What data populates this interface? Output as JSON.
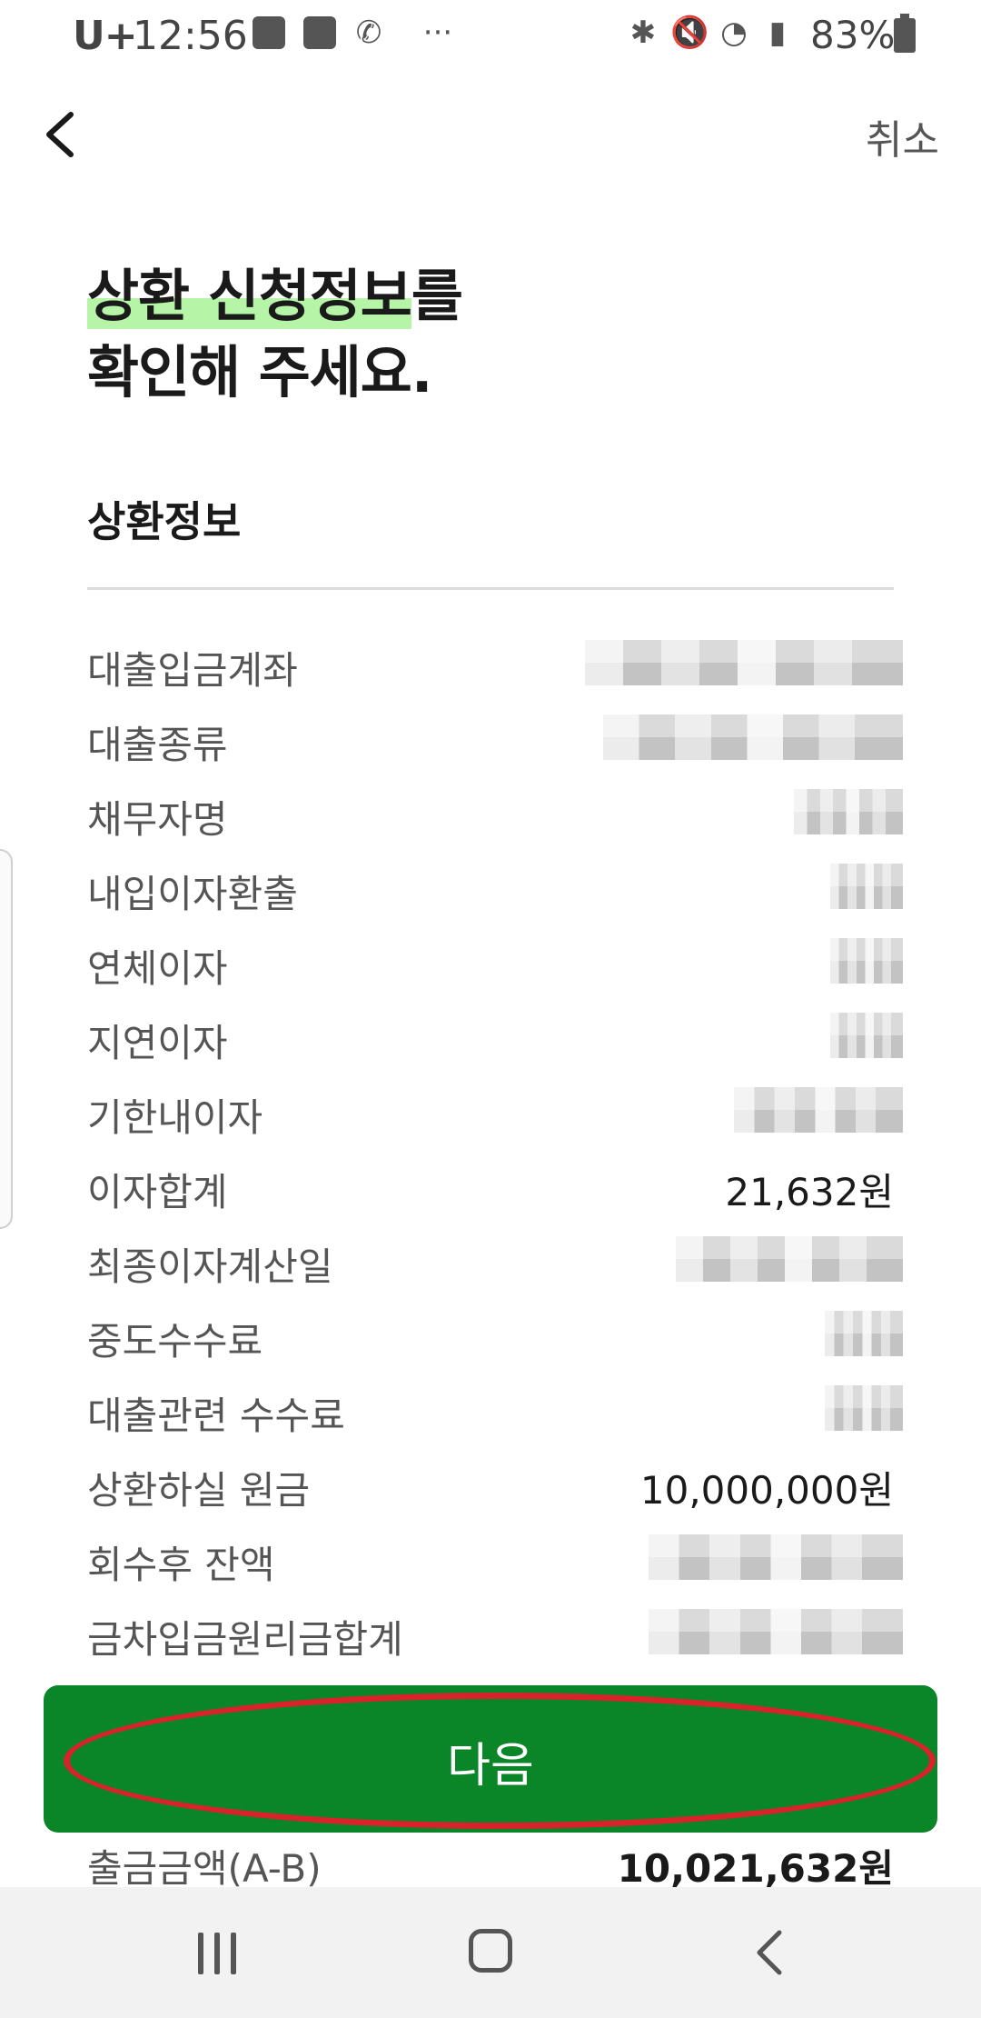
{
  "status_bar": {
    "carrier": "U+",
    "time": "12:56",
    "more": "···",
    "battery": "83%"
  },
  "header": {
    "cancel_label": "취소"
  },
  "headline": {
    "line1_highlight": "상환 신청정보",
    "line1_rest": "를",
    "line2": "확인해 주세요."
  },
  "section": {
    "title": "상환정보"
  },
  "rows": [
    {
      "label": "대출입금계좌",
      "value": null
    },
    {
      "label": "대출종류",
      "value": null
    },
    {
      "label": "채무자명",
      "value": null
    },
    {
      "label": "내입이자환출",
      "value": null
    },
    {
      "label": "연체이자",
      "value": null
    },
    {
      "label": "지연이자",
      "value": null
    },
    {
      "label": "기한내이자",
      "value": null
    },
    {
      "label": "이자합계",
      "value": "21,632원"
    },
    {
      "label": "최종이자계산일",
      "value": null
    },
    {
      "label": "중도수수료",
      "value": null
    },
    {
      "label": "대출관련 수수료",
      "value": null
    },
    {
      "label": "상환하실 원금",
      "value": "10,000,000원"
    },
    {
      "label": "회수후 잔액",
      "value": null
    },
    {
      "label": "금차입금원리금합계",
      "value": null
    },
    {
      "label": "출금금액(A-B)",
      "value": "10,021,632원"
    }
  ],
  "button": {
    "next_label": "다음"
  },
  "colors": {
    "primary_green": "#0a8528",
    "highlight": "#b6f5a8",
    "annotation_red": "#d8232a"
  }
}
